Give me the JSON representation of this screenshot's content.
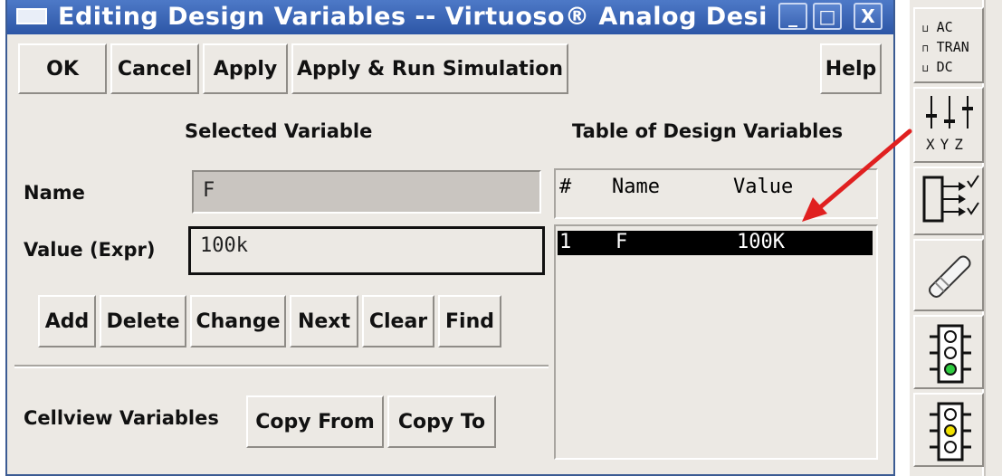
{
  "window": {
    "title": "Editing Design Variables -- Virtuoso® Analog Desi",
    "minimize": "_",
    "maximize": "□",
    "close": "X"
  },
  "buttons": {
    "ok": "OK",
    "cancel": "Cancel",
    "apply": "Apply",
    "apply_run": "Apply & Run Simulation",
    "help": "Help"
  },
  "selected_variable": {
    "heading": "Selected Variable",
    "name_label": "Name",
    "name_value": "F",
    "value_label": "Value (Expr)",
    "value_value": "100k",
    "actions": [
      "Add",
      "Delete",
      "Change",
      "Next",
      "Clear",
      "Find"
    ]
  },
  "cellview": {
    "label": "Cellview Variables",
    "copy_from": "Copy From",
    "copy_to": "Copy To"
  },
  "table": {
    "heading": "Table of Design Variables",
    "columns": [
      "#",
      "Name",
      "Value"
    ],
    "rows": [
      {
        "index": "1",
        "name": "F",
        "value": "100K",
        "selected": true
      }
    ]
  },
  "toolbar": {
    "analyses": [
      "AC",
      "TRAN",
      "DC"
    ],
    "axes": [
      "X",
      "Y",
      "Z"
    ],
    "icons": [
      "analysis-selector-icon",
      "xyz-sliders-icon",
      "output-select-icon",
      "pen-icon",
      "traffic-light-run-icon",
      "traffic-light-stop-icon"
    ]
  },
  "colors": {
    "titlebar": "#3a63b3",
    "arrow": "#e02020",
    "selection": "#000000"
  }
}
